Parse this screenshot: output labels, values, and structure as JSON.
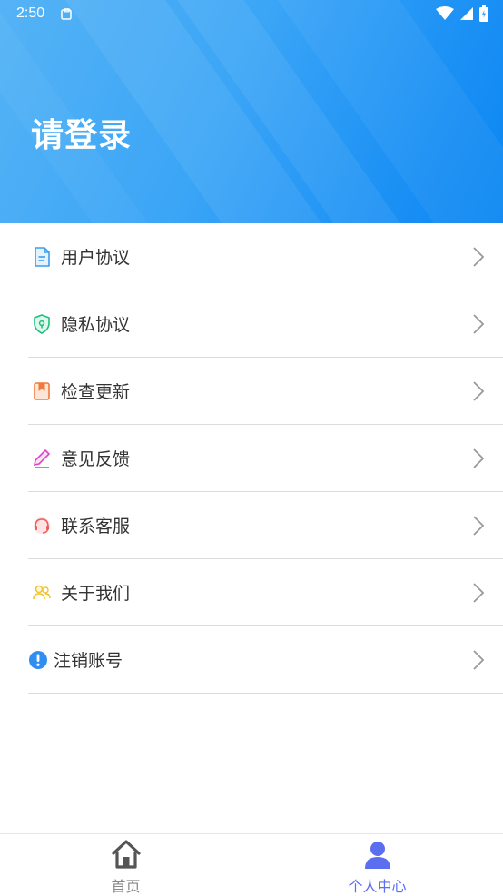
{
  "status_bar": {
    "time": "2:50"
  },
  "header": {
    "title": "请登录"
  },
  "menu": {
    "items": [
      {
        "label": "用户协议",
        "icon": "document-icon"
      },
      {
        "label": "隐私协议",
        "icon": "shield-lock-icon"
      },
      {
        "label": "检查更新",
        "icon": "bookmark-icon"
      },
      {
        "label": "意见反馈",
        "icon": "pencil-icon"
      },
      {
        "label": "联系客服",
        "icon": "headset-icon"
      },
      {
        "label": "关于我们",
        "icon": "people-icon"
      },
      {
        "label": "注销账号",
        "icon": "exclamation-circle-icon"
      }
    ]
  },
  "bottom_nav": {
    "tabs": [
      {
        "label": "首页",
        "icon": "home-icon",
        "active": false
      },
      {
        "label": "个人中心",
        "icon": "user-icon",
        "active": true
      }
    ]
  },
  "colors": {
    "header_start": "#55b3f5",
    "header_end": "#0a86f2",
    "active_tab": "#5b6ef0",
    "inactive_tab": "#888888",
    "divider": "#dcdcdc"
  }
}
